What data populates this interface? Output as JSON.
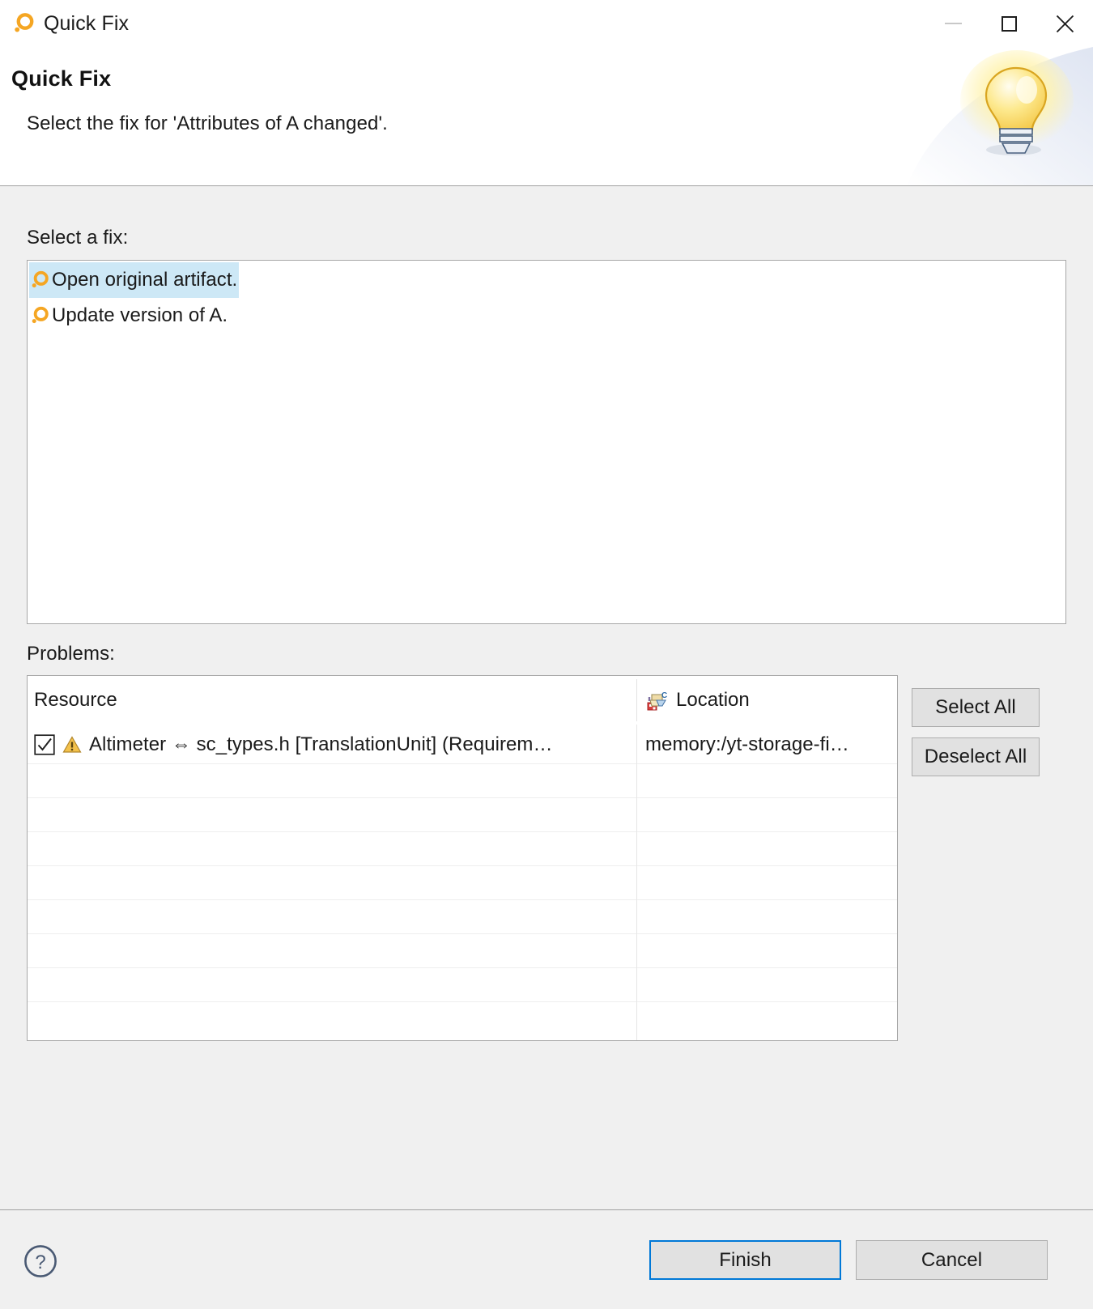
{
  "window": {
    "title": "Quick Fix",
    "icon": "quickfix-orange-ring-icon",
    "controls": {
      "minimize": "minimize-icon",
      "maximize": "maximize-icon",
      "close": "close-icon"
    }
  },
  "header": {
    "title": "Quick Fix",
    "description": "Select the fix for 'Attributes of A changed'.",
    "art": "lightbulb-illustration"
  },
  "main": {
    "select_fix_label": "Select a fix:",
    "fixes": [
      {
        "label": "Open original artifact.",
        "icon": "quickfix-orange-ring-icon",
        "selected": true
      },
      {
        "label": "Update version of A.",
        "icon": "quickfix-orange-ring-icon",
        "selected": false
      }
    ],
    "problems_label": "Problems:",
    "problems_table": {
      "columns": [
        {
          "key": "resource",
          "label": "Resource",
          "icon": null
        },
        {
          "key": "location",
          "label": "Location",
          "icon": "c-source-location-icon"
        }
      ],
      "rows": [
        {
          "checked": true,
          "severity": "warning",
          "resource": "Altimeter ⇔ sc_types.h [TranslationUnit] (Requirem…",
          "location": "memory:/yt-storage-fi…"
        }
      ],
      "empty_row_count": 8
    },
    "select_all_label": "Select All",
    "deselect_all_label": "Deselect All"
  },
  "footer": {
    "help_label": "?",
    "finish_label": "Finish",
    "cancel_label": "Cancel"
  },
  "colors": {
    "dialog_background": "#f0f0f0",
    "panel_background": "#ffffff",
    "selection_highlight": "#cde8f6",
    "accent_blue": "#0078d7",
    "accent_orange": "#f6a609",
    "border_grey": "#a7a7a7",
    "button_face": "#e1e1e1",
    "text": "#1a1a1a"
  }
}
